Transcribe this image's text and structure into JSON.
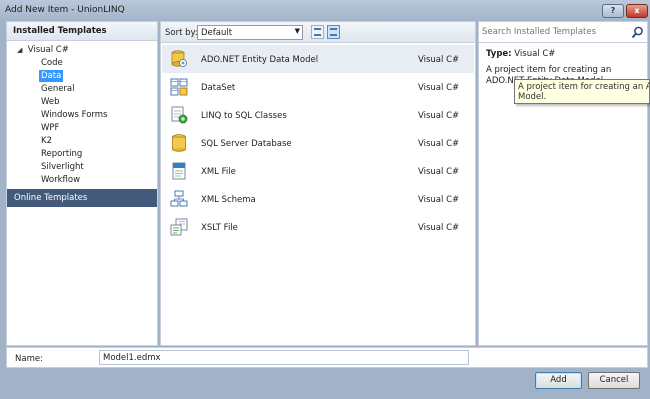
{
  "window": {
    "title": "Add New Item - UnionLINQ",
    "help_label": "?",
    "close_label": "x"
  },
  "left": {
    "header": "Installed Templates",
    "root_label": "Visual C#",
    "items": [
      "Code",
      "Data",
      "General",
      "Web",
      "Windows Forms",
      "WPF",
      "K2",
      "Reporting",
      "Silverlight",
      "Workflow"
    ],
    "selected": "Data",
    "online": "Online Templates"
  },
  "toolbar": {
    "sort_label": "Sort by:",
    "sort_value": "Default"
  },
  "templates": [
    {
      "name": "ADO.NET Entity Data Model",
      "language": "Visual C#",
      "icon": "entity-model-icon",
      "selected": true
    },
    {
      "name": "DataSet",
      "language": "Visual C#",
      "icon": "dataset-icon"
    },
    {
      "name": "LINQ to SQL Classes",
      "language": "Visual C#",
      "icon": "linq-icon"
    },
    {
      "name": "SQL Server Database",
      "language": "Visual C#",
      "icon": "database-icon"
    },
    {
      "name": "XML File",
      "language": "Visual C#",
      "icon": "xml-file-icon"
    },
    {
      "name": "XML Schema",
      "language": "Visual C#",
      "icon": "xml-schema-icon"
    },
    {
      "name": "XSLT File",
      "language": "Visual C#",
      "icon": "xslt-file-icon"
    }
  ],
  "details": {
    "search_placeholder": "Search Installed Templates",
    "type_label": "Type:",
    "type_value": "Visual C#",
    "description": "A project item for creating an ADO.NET Entity Data Model.",
    "tooltip_line1": "A project item for creating an ADO.N",
    "tooltip_line2": "Model."
  },
  "name_field": {
    "label": "Name:",
    "value": "Model1.edmx"
  },
  "buttons": {
    "add": "Add",
    "cancel": "Cancel"
  },
  "colors": {
    "selection": "#3399ff",
    "online_bg": "#445a7a",
    "frame": "#a3b3c7"
  }
}
